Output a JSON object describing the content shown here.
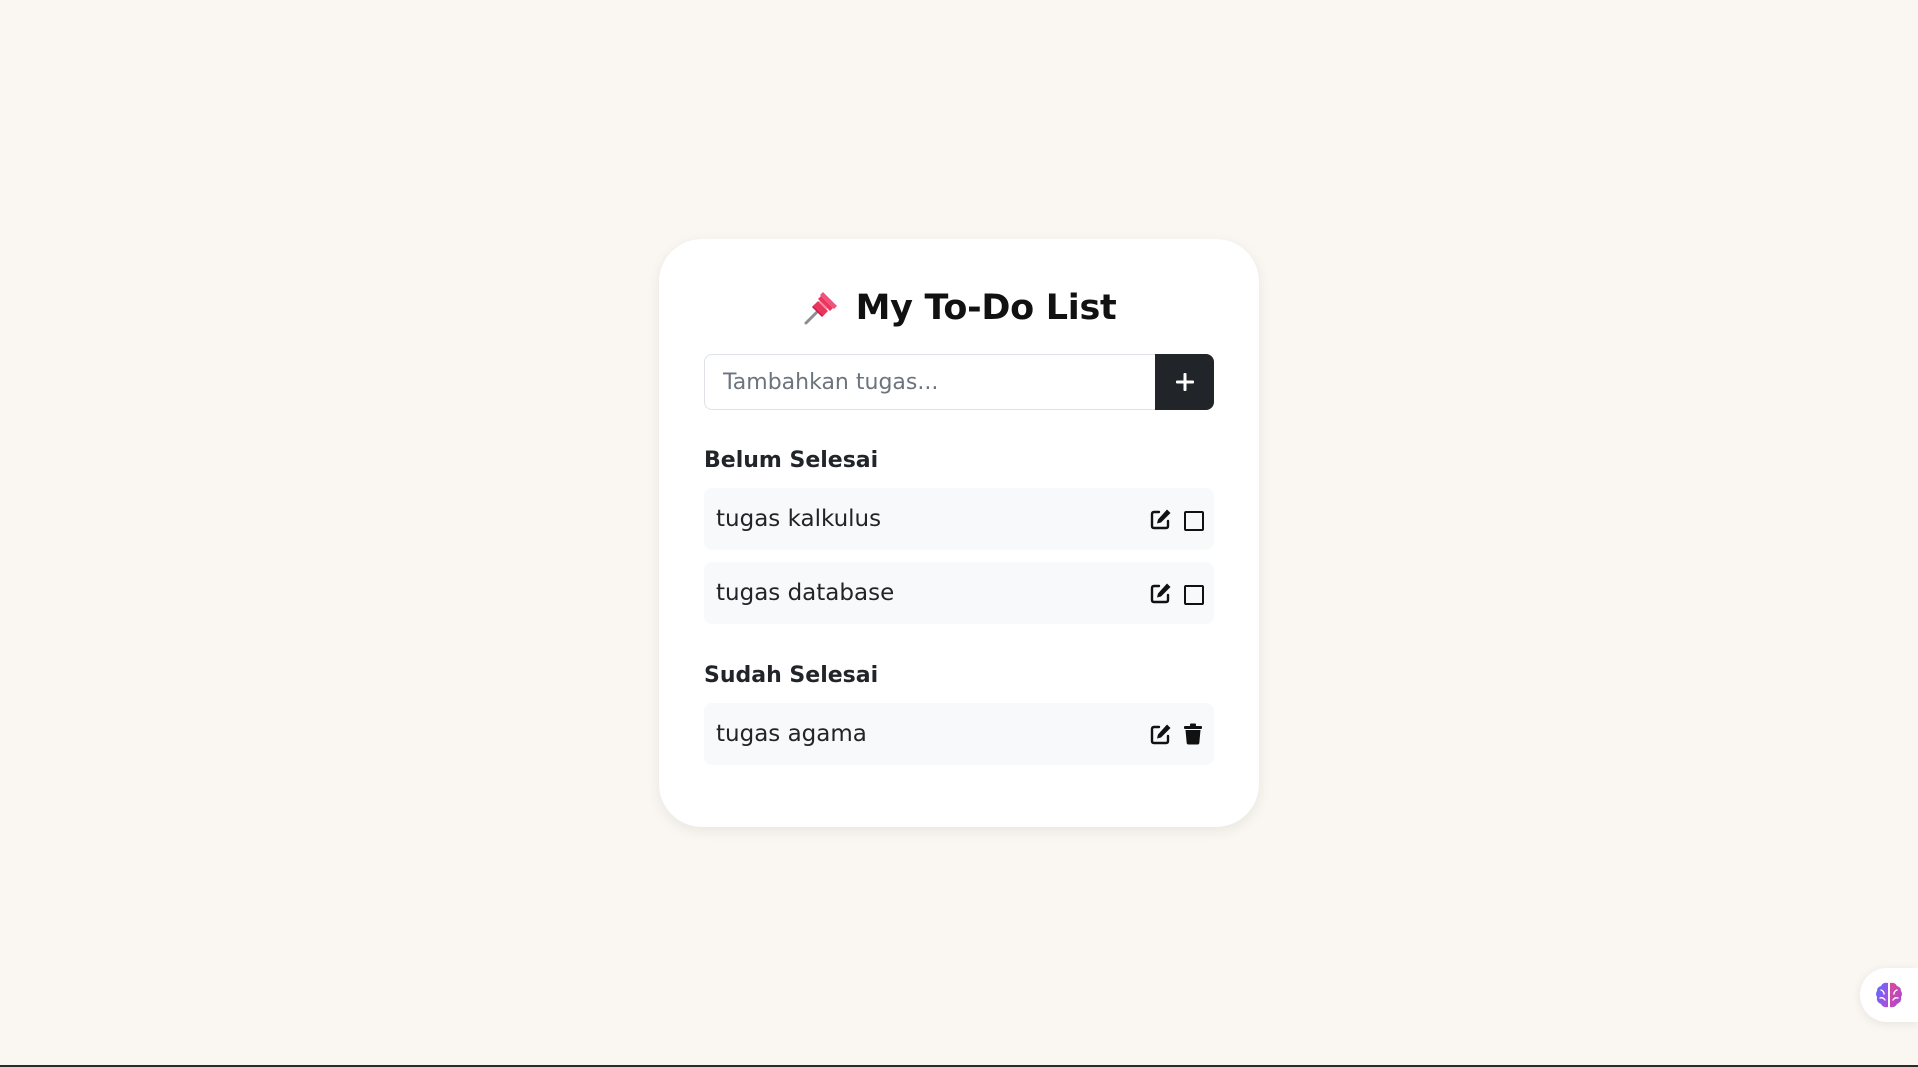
{
  "app": {
    "title": "My To-Do List"
  },
  "add_form": {
    "placeholder": "Tambahkan tugas...",
    "value": "",
    "add_icon": "plus-icon"
  },
  "sections": {
    "pending": {
      "title": "Belum Selesai",
      "items": [
        {
          "text": "tugas kalkulus",
          "icons": [
            "edit-icon",
            "checkbox-unchecked"
          ]
        },
        {
          "text": "tugas database",
          "icons": [
            "edit-icon",
            "checkbox-unchecked"
          ]
        }
      ]
    },
    "done": {
      "title": "Sudah Selesai",
      "items": [
        {
          "text": "tugas agama",
          "icons": [
            "edit-icon",
            "trash-icon"
          ]
        }
      ]
    }
  },
  "widget": {
    "icon": "brain-icon"
  },
  "colors": {
    "background": "#faf6f2",
    "card": "#ffffff",
    "button": "#212529",
    "item_bg": "#f8f9fa",
    "pin": "#e8365d"
  }
}
